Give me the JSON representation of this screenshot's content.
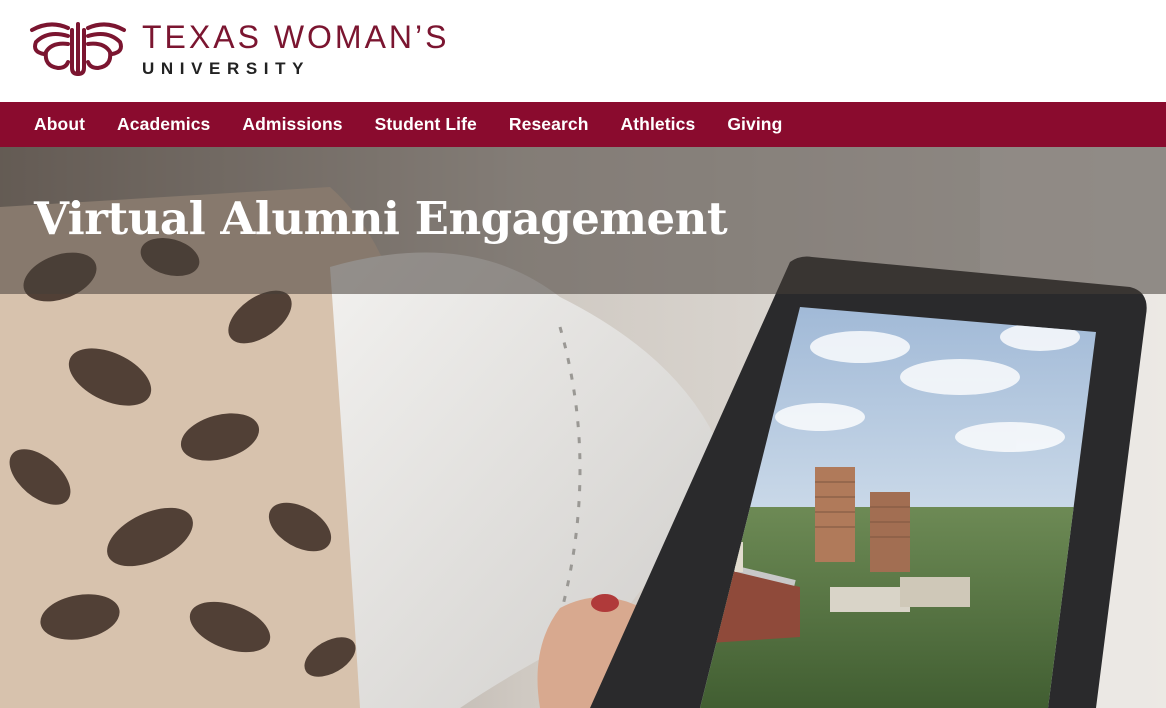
{
  "header": {
    "logo_line1": "TEXAS WOMAN’S",
    "logo_line2": "UNIVERSITY",
    "brand_color": "#7b1530",
    "logo_icon": "twu-wings-icon"
  },
  "nav": {
    "background": "#8a0b2e",
    "items": [
      {
        "label": "About"
      },
      {
        "label": "Academics"
      },
      {
        "label": "Admissions"
      },
      {
        "label": "Student Life"
      },
      {
        "label": "Research"
      },
      {
        "label": "Athletics"
      },
      {
        "label": "Giving"
      }
    ]
  },
  "hero": {
    "title": "Virtual Alumni Engagement"
  }
}
